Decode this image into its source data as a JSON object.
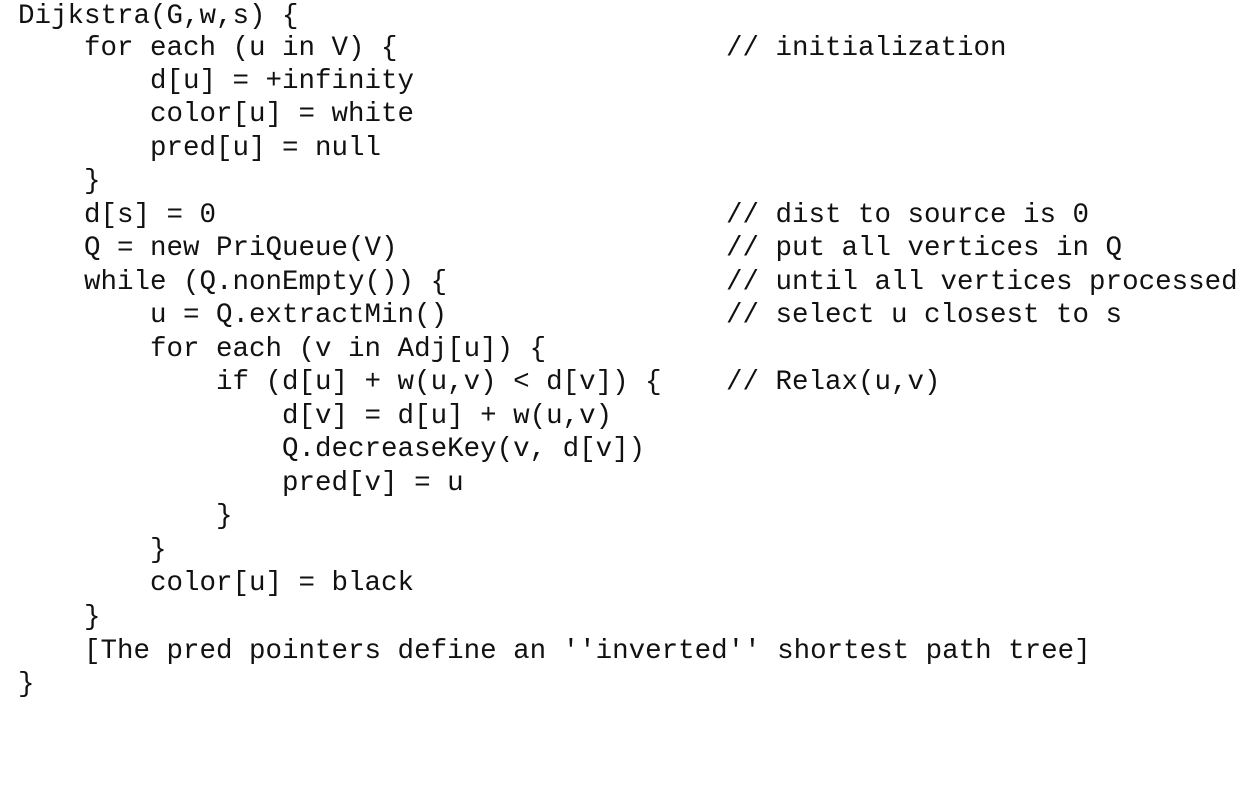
{
  "document": {
    "lines": [
      {
        "code": "Dijkstra(G,w,s) {",
        "comment": ""
      },
      {
        "code": "    for each (u in V) {",
        "comment": "// initialization"
      },
      {
        "code": "        d[u] = +infinity",
        "comment": ""
      },
      {
        "code": "        color[u] = white",
        "comment": ""
      },
      {
        "code": "        pred[u] = null",
        "comment": ""
      },
      {
        "code": "    }",
        "comment": ""
      },
      {
        "code": "    d[s] = 0",
        "comment": "// dist to source is 0"
      },
      {
        "code": "    Q = new PriQueue(V)",
        "comment": "// put all vertices in Q"
      },
      {
        "code": "    while (Q.nonEmpty()) {",
        "comment": "// until all vertices processed"
      },
      {
        "code": "        u = Q.extractMin()",
        "comment": "// select u closest to s"
      },
      {
        "code": "        for each (v in Adj[u]) {",
        "comment": ""
      },
      {
        "code": "            if (d[u] + w(u,v) < d[v]) {",
        "comment": "// Relax(u,v)"
      },
      {
        "code": "                d[v] = d[u] + w(u,v)",
        "comment": ""
      },
      {
        "code": "                Q.decreaseKey(v, d[v])",
        "comment": ""
      },
      {
        "code": "                pred[v] = u",
        "comment": ""
      },
      {
        "code": "            }",
        "comment": ""
      },
      {
        "code": "        }",
        "comment": ""
      },
      {
        "code": "        color[u] = black",
        "comment": ""
      },
      {
        "code": "    }",
        "comment": ""
      },
      {
        "code": "    [The pred pointers define an ''inverted'' shortest path tree]",
        "comment": ""
      },
      {
        "code": "}",
        "comment": ""
      }
    ]
  }
}
